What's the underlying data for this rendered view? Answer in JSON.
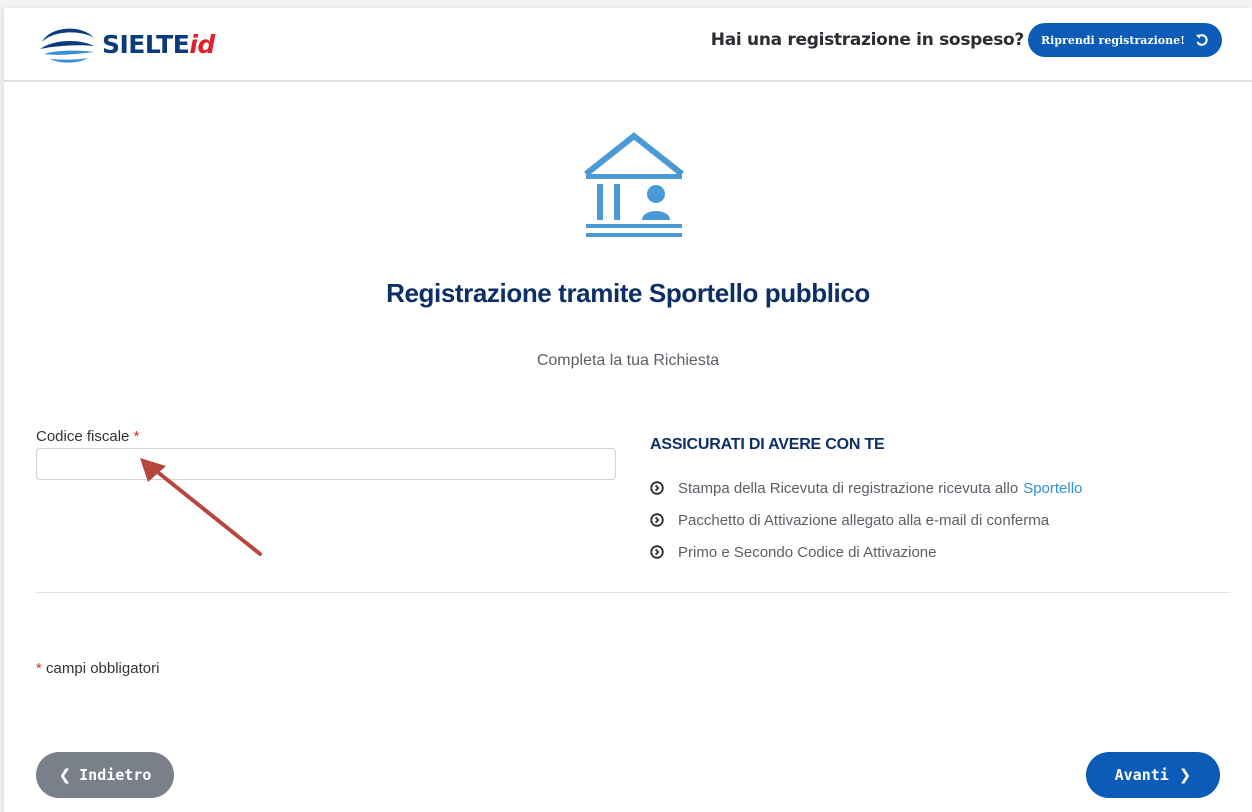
{
  "header": {
    "logo_main": "SIELTE",
    "logo_suffix": "id",
    "pending_question": "Hai una registrazione in sospeso?",
    "resume_button": "Riprendi registrazione!"
  },
  "main": {
    "icon": "public-office-building-icon",
    "title": "Registrazione tramite Sportello pubblico",
    "subtitle": "Completa la tua Richiesta"
  },
  "form": {
    "codice_fiscale": {
      "label": "Codice fiscale",
      "required_mark": "*",
      "value": "",
      "placeholder": ""
    }
  },
  "info": {
    "title": "ASSICURATI DI AVERE CON TE",
    "items": [
      {
        "text": "Stampa della Ricevuta di registrazione ricevuta allo",
        "link": "Sportello"
      },
      {
        "text": "Pacchetto di Attivazione allegato alla e-mail di conferma"
      },
      {
        "text": "Primo e Secondo Codice di Attivazione"
      }
    ]
  },
  "footer": {
    "required_mark": "*",
    "mandatory_note": "campi obbligatori",
    "back_button": "Indietro",
    "next_button": "Avanti"
  },
  "colors": {
    "primary": "#0b5bb7",
    "title": "#0c2f66",
    "icon": "#4a9ad8",
    "secondary_button": "#7a8089",
    "required": "#d03030",
    "annotation_arrow": "#b5473e"
  }
}
